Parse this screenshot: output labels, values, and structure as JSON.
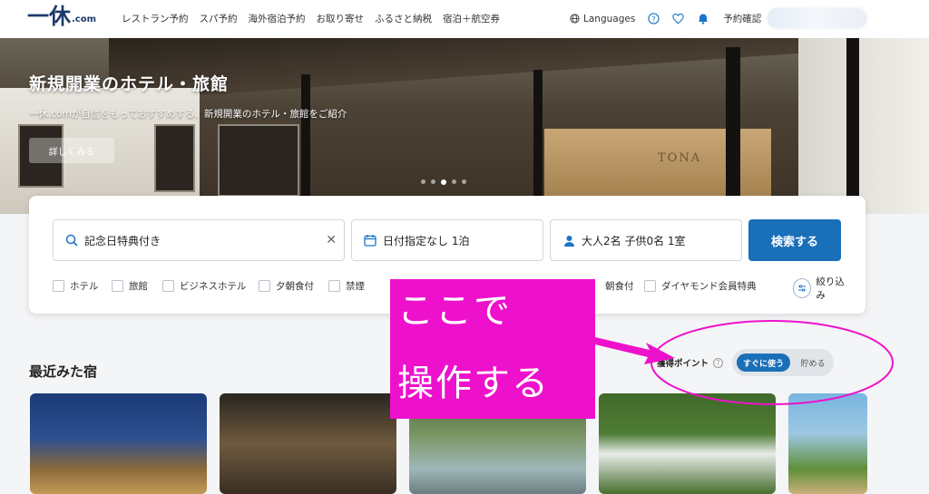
{
  "header": {
    "logo_text": "一休",
    "logo_suffix": ".com",
    "nav": [
      "レストラン予約",
      "スパ予約",
      "海外宿泊予約",
      "お取り寄せ",
      "ふるさと納税",
      "宿泊＋航空券"
    ],
    "languages_label": "Languages",
    "reserve_label": "予約確認"
  },
  "hero": {
    "title": "新規開業のホテル・旅館",
    "subtitle": "一休.comが自信をもっておすすめする、新規開業のホテル・旅館をご紹介",
    "button_label": "詳しくみる",
    "slide_count": 5,
    "active_slide": 3,
    "sign_text": "TONA"
  },
  "search": {
    "keyword": "記念日特典付き",
    "date": "日付指定なし 1泊",
    "guests": "大人2名 子供0名 1室",
    "button_label": "検索する",
    "filters": [
      "ホテル",
      "旅館",
      "ビジネスホテル",
      "夕朝食付",
      "禁煙",
      "朝食付",
      "ダイヤモンド会員特典"
    ],
    "narrow_label": "絞り込み"
  },
  "recent": {
    "title": "最近みた宿",
    "points_label": "獲得ポイント",
    "toggle_on": "すぐに使う",
    "toggle_off": "貯める"
  },
  "annotation": {
    "line1": "ここで",
    "line2": "操作する",
    "color": "#ee11cc"
  },
  "colors": {
    "brand": "#1d3a6e",
    "accent": "#1a6fb9",
    "icon": "#1a73c9"
  }
}
